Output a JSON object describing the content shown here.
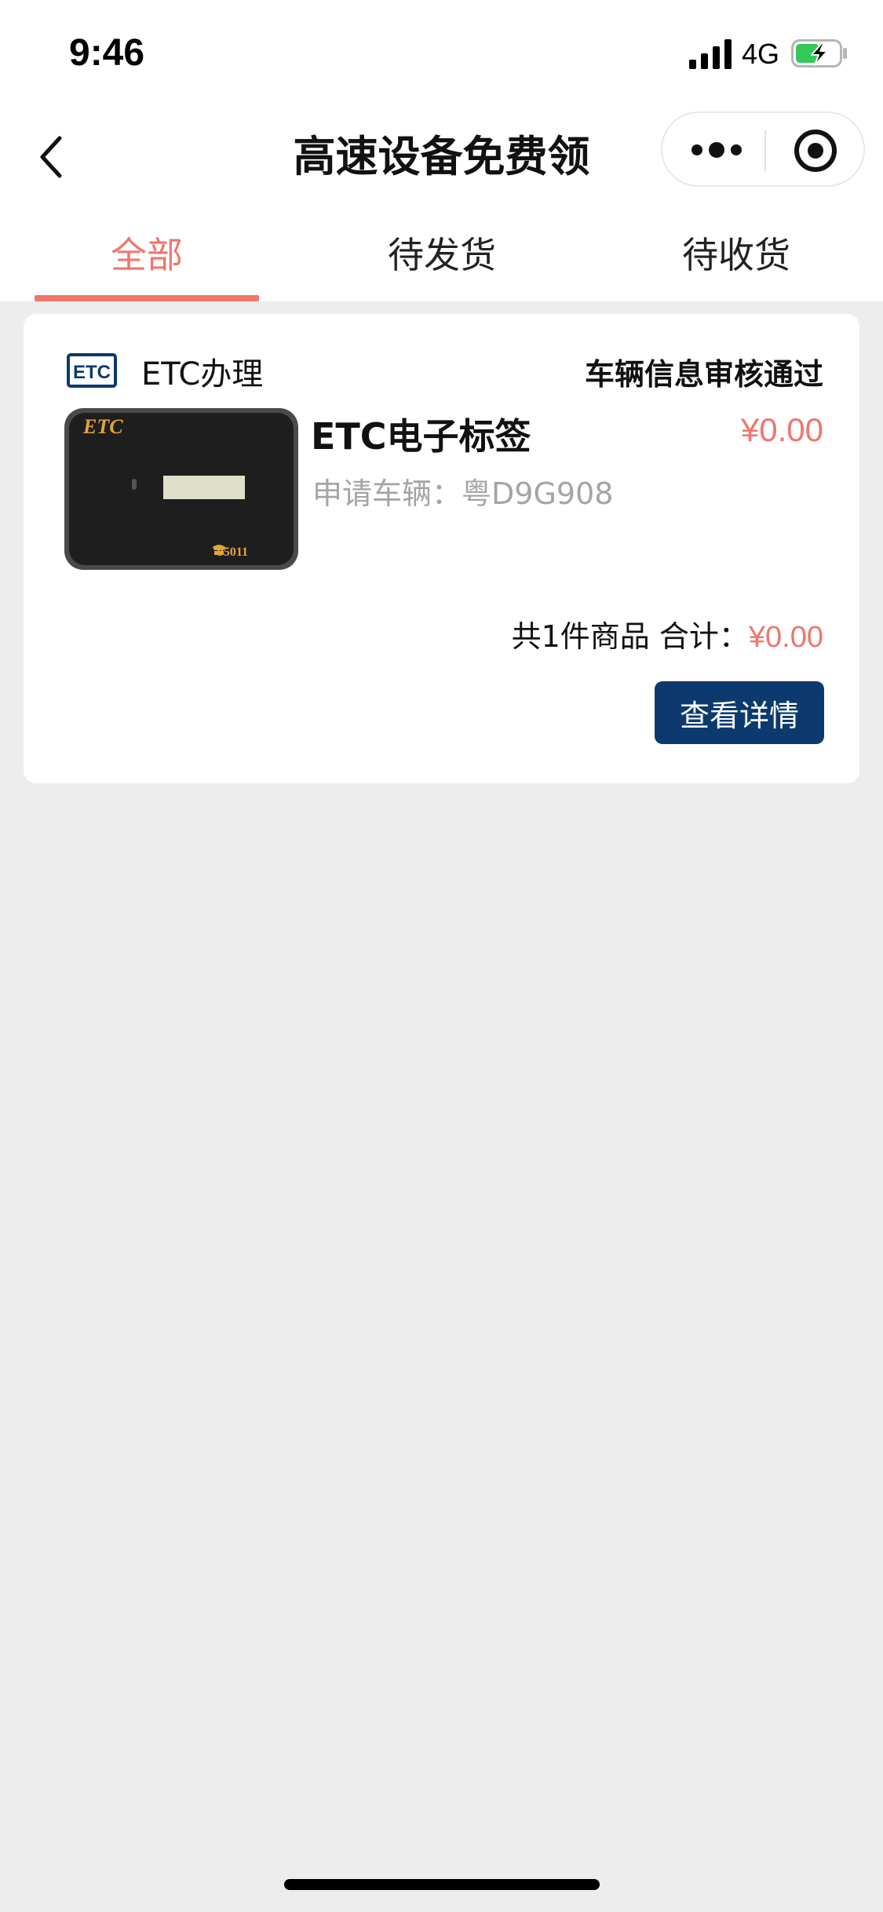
{
  "status_bar": {
    "time": "9:46",
    "network": "4G",
    "signal_icon": "cellular-signal-icon",
    "battery_icon": "battery-charging-icon"
  },
  "nav": {
    "title": "高速设备免费领",
    "back_icon": "chevron-left-icon",
    "more_icon": "more-dots-icon",
    "close_icon": "target-circle-icon"
  },
  "tabs": [
    {
      "label": "全部",
      "active": true
    },
    {
      "label": "待发货",
      "active": false
    },
    {
      "label": "待收货",
      "active": false
    }
  ],
  "order": {
    "shop_logo_text": "ETC",
    "shop_name": "ETC办理",
    "status": "车辆信息审核通过",
    "product": {
      "name": "ETC电子标签",
      "price": "¥0.00",
      "vehicle_label": "申请车辆：",
      "vehicle_plate": "粤D9G908",
      "image_text_brand": "ETC",
      "image_text_phone": "95011"
    },
    "summary": {
      "count_text": "共1件商品",
      "total_label": "合计：",
      "total_value": "¥0.00"
    },
    "detail_button": "查看详情"
  },
  "colors": {
    "accent": "#f0766c",
    "button_bg": "#0c3a6e",
    "page_bg": "#ededed"
  }
}
